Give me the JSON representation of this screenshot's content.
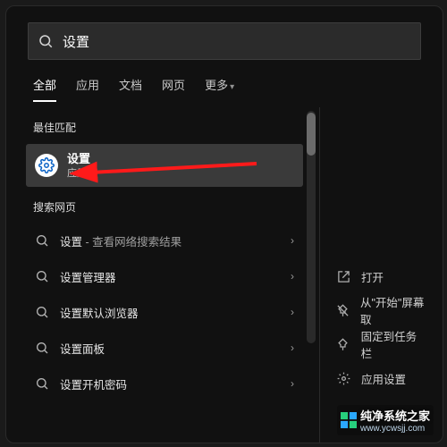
{
  "search": {
    "value": "设置"
  },
  "tabs": {
    "items": [
      "全部",
      "应用",
      "文档",
      "网页",
      "更多"
    ],
    "activeIndex": 0
  },
  "sections": {
    "bestMatch": "最佳匹配",
    "webSearch": "搜索网页"
  },
  "bestResult": {
    "title": "设置",
    "subtitle": "应用"
  },
  "webResults": [
    {
      "prefix": "设置",
      "suffix": " - 查看网络搜索结果"
    },
    {
      "prefix": "设置管理器",
      "suffix": ""
    },
    {
      "prefix": "设置默认浏览器",
      "suffix": ""
    },
    {
      "prefix": "设置面板",
      "suffix": ""
    },
    {
      "prefix": "设置开机密码",
      "suffix": ""
    }
  ],
  "contextMenu": {
    "open": "打开",
    "unpinStart": "从\"开始\"屏幕取",
    "pinTaskbar": "固定到任务栏",
    "appSettings": "应用设置"
  },
  "watermark": {
    "title": "纯净系统之家",
    "domain": "www.ycwsjj.com"
  }
}
